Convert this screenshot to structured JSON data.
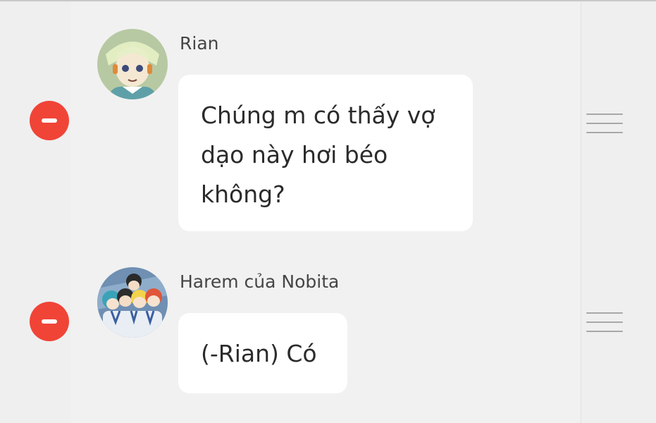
{
  "colors": {
    "background": "#efefef",
    "bubble": "#ffffff",
    "delete_button": "#f04437",
    "sender_text": "#454545",
    "message_text": "#2b2b2b",
    "handle": "#a8a8a8"
  },
  "messages": [
    {
      "sender": "Rian",
      "lines": [
        "Chúng m có thấy vợ",
        "dạo này hơi béo",
        "không?"
      ],
      "avatar_icon": "anime-boy-avatar-icon"
    },
    {
      "sender": "Harem của Nobita",
      "lines": [
        "(-Rian) Có"
      ],
      "avatar_icon": "group-anime-avatar-icon"
    }
  ],
  "icons": {
    "delete": "minus-circle-icon",
    "reorder": "drag-handle-icon"
  }
}
